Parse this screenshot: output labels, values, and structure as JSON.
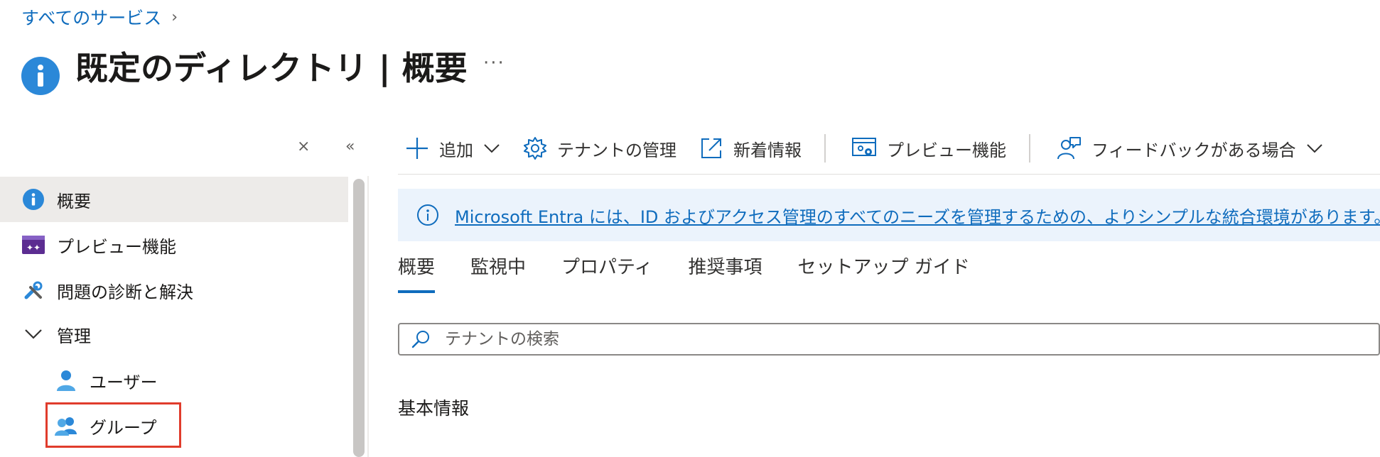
{
  "breadcrumb": {
    "label": "すべてのサービス",
    "chevron": "›"
  },
  "header": {
    "title": "既定のディレクトリ | 概要",
    "more": "···"
  },
  "sidebar": {
    "close_glyph": "⨯",
    "collapse_glyph": "«",
    "items": [
      {
        "label": "概要",
        "icon": "info-icon",
        "selected": true
      },
      {
        "label": "プレビュー機能",
        "icon": "preview-icon"
      },
      {
        "label": "問題の診断と解決",
        "icon": "wrench-icon"
      },
      {
        "label": "管理",
        "icon": "chevron-down-icon",
        "chevron": "∨"
      },
      {
        "label": "ユーザー",
        "icon": "user-icon"
      },
      {
        "label": "グループ",
        "icon": "group-icon"
      }
    ]
  },
  "toolbar": {
    "add": "追加",
    "tenant_manage": "テナントの管理",
    "whats_new": "新着情報",
    "preview": "プレビュー機能",
    "feedback": "フィードバックがある場合"
  },
  "banner": {
    "text": "Microsoft Entra には、ID およびアクセス管理のすべてのニーズを管理するための、よりシンプルな統合環境があります。"
  },
  "tabs": [
    "概要",
    "監視中",
    "プロパティ",
    "推奨事項",
    "セットアップ ガイド"
  ],
  "search": {
    "placeholder": "テナントの検索",
    "value": ""
  },
  "section": {
    "title": "基本情報"
  },
  "colors": {
    "accent": "#0f6cbd",
    "selected_bg": "#edebe9",
    "highlight": "#e03c2c"
  }
}
